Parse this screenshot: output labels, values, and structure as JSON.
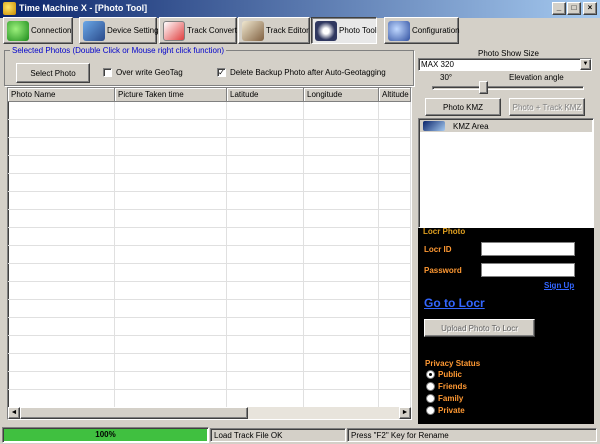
{
  "window": {
    "title": "Time Machine X - [Photo Tool]",
    "minimize": "_",
    "maximize": "□",
    "close": "×"
  },
  "toolbar": {
    "tabs": [
      {
        "label": "Connection",
        "icon": "connection-icon"
      },
      {
        "label": "Device Setting",
        "icon": "device-setting-icon"
      },
      {
        "label": "Track Convert",
        "icon": "track-convert-icon"
      },
      {
        "label": "Track Editor",
        "icon": "track-editor-icon"
      },
      {
        "label": "Photo Tool",
        "icon": "photo-tool-icon",
        "active": true
      },
      {
        "label": "Configuration",
        "icon": "configuration-icon"
      }
    ]
  },
  "photos": {
    "group_title": "Selected Photos (Double Click or Mouse right click function)",
    "select_button": "Select Photo",
    "overwrite_label": "Over write GeoTag",
    "overwrite_checked": false,
    "delete_backup_label": "Delete Backup Photo after Auto-Geotagging",
    "delete_backup_checked": true,
    "check_mark": "✓",
    "columns": [
      "Photo Name",
      "Picture Taken time",
      "Latitude",
      "Longitude",
      "Altitude"
    ],
    "scroll_left": "◄",
    "scroll_right": "►"
  },
  "photo_show": {
    "title": "Photo Show Size",
    "selected_size": "MAX 320",
    "dropdown_arrow": "▼",
    "angle_value": "30°",
    "angle_label": "Elevation angle",
    "photo_kmz_button": "Photo KMZ",
    "photo_track_kmz_button": "Photo + Track KMZ",
    "kmz_area_label": "KMZ Area"
  },
  "locr": {
    "title": "Locr Photo",
    "id_label": "Locr ID",
    "id_value": "",
    "password_label": "Password",
    "password_value": "",
    "signup_link": "Sign Up",
    "goto_link": "Go to Locr",
    "upload_button": "Upload Photo To Locr",
    "privacy_title": "Privacy Status",
    "privacy_options": [
      "Public",
      "Friends",
      "Family",
      "Private"
    ],
    "privacy_selected": "Public"
  },
  "status": {
    "progress_percent": 100,
    "progress_text": "100%",
    "message": "Load Track File OK",
    "hint": "Press \"F2\" Key  for Rename"
  },
  "colors": {
    "title_bar_start": "#0a246a",
    "title_bar_end": "#a6caf0",
    "progress": "#40c040",
    "locr_panel": "#000000",
    "locr_label": "#ff9933",
    "link": "#3366ff"
  }
}
